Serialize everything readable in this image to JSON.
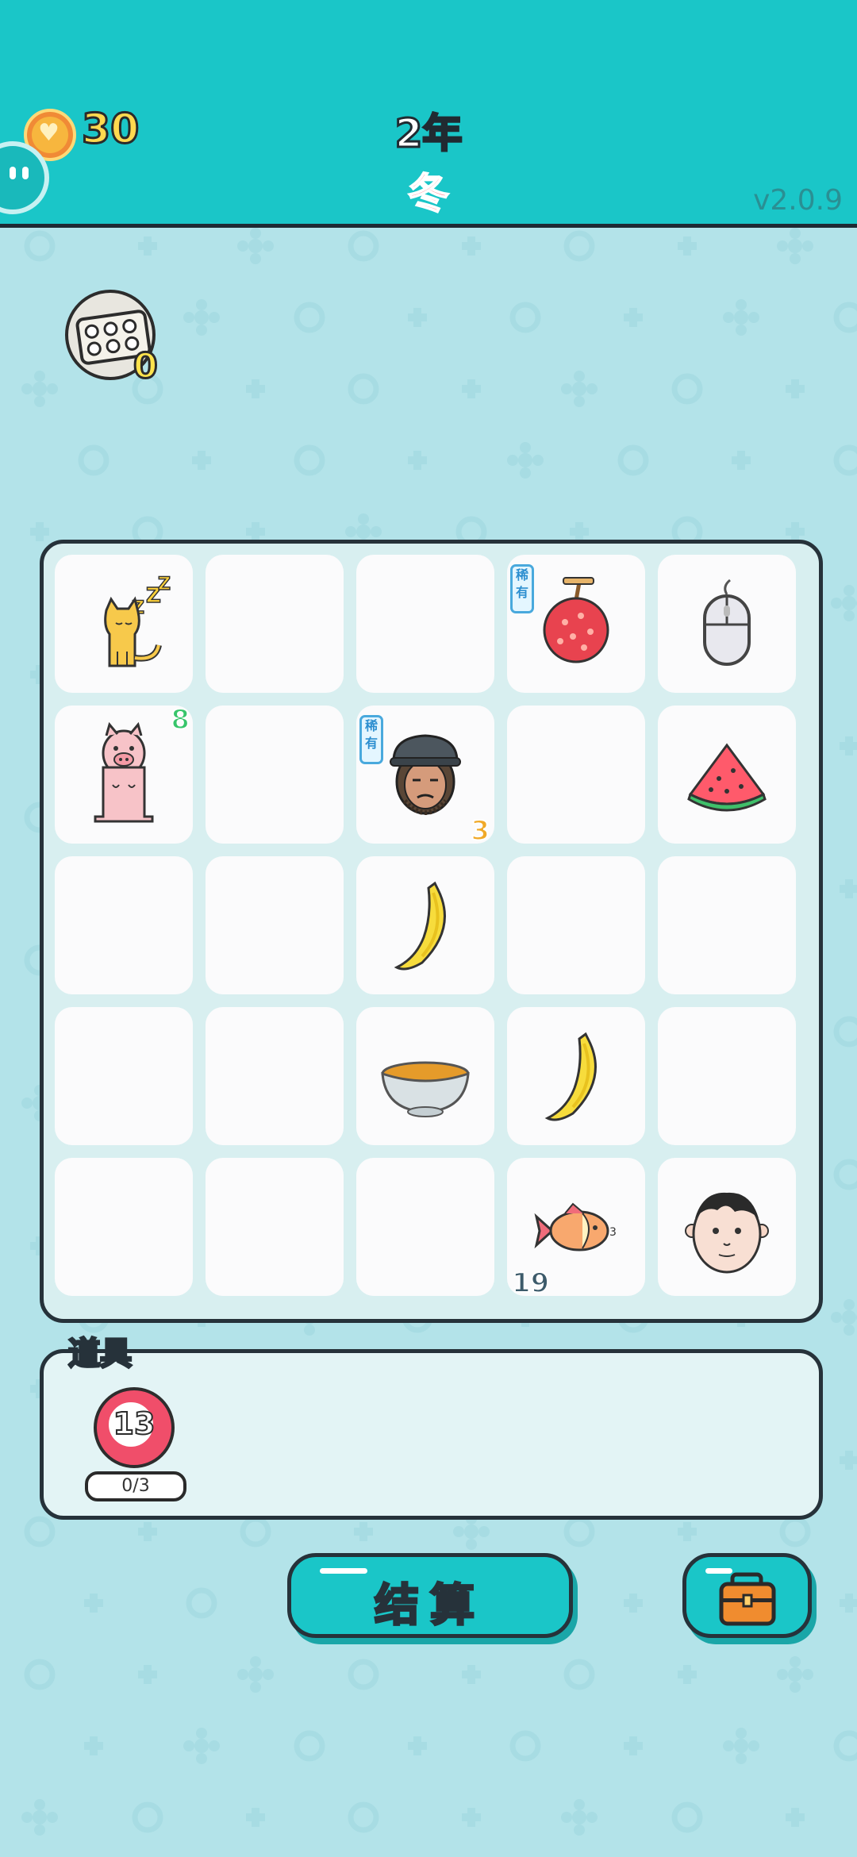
{
  "header": {
    "coins": "30",
    "year": "2年",
    "season": "冬",
    "version": "v2.0.9"
  },
  "egg_tray": {
    "count": "0"
  },
  "board": {
    "rows": 5,
    "cols": 5,
    "cells": [
      {
        "item": "sleeping-cat",
        "rare": false,
        "count": ""
      },
      {
        "item": "",
        "rare": false,
        "count": ""
      },
      {
        "item": "",
        "rare": false,
        "count": ""
      },
      {
        "item": "lychee",
        "rare": true,
        "count": ""
      },
      {
        "item": "computer-mouse",
        "rare": false,
        "count": ""
      },
      {
        "item": "pig",
        "rare": false,
        "count": "8"
      },
      {
        "item": "",
        "rare": false,
        "count": ""
      },
      {
        "item": "hat-man",
        "rare": true,
        "count": "3"
      },
      {
        "item": "",
        "rare": false,
        "count": ""
      },
      {
        "item": "watermelon-slice",
        "rare": false,
        "count": ""
      },
      {
        "item": "",
        "rare": false,
        "count": ""
      },
      {
        "item": "",
        "rare": false,
        "count": ""
      },
      {
        "item": "banana",
        "rare": false,
        "count": ""
      },
      {
        "item": "",
        "rare": false,
        "count": ""
      },
      {
        "item": "",
        "rare": false,
        "count": ""
      },
      {
        "item": "",
        "rare": false,
        "count": ""
      },
      {
        "item": "",
        "rare": false,
        "count": ""
      },
      {
        "item": "soup-bowl",
        "rare": false,
        "count": ""
      },
      {
        "item": "banana",
        "rare": false,
        "count": ""
      },
      {
        "item": "",
        "rare": false,
        "count": ""
      },
      {
        "item": "",
        "rare": false,
        "count": ""
      },
      {
        "item": "",
        "rare": false,
        "count": ""
      },
      {
        "item": "",
        "rare": false,
        "count": ""
      },
      {
        "item": "goldfish",
        "rare": false,
        "count": "19"
      },
      {
        "item": "man-face",
        "rare": false,
        "count": ""
      }
    ],
    "rare_label": "稀有",
    "count_colors": {
      "pig": "#37c56b",
      "hat-man": "#f0a928",
      "goldfish": "#3c5a6a"
    }
  },
  "tools": {
    "label": "道具",
    "item_icon": "target-icon",
    "item_value": "13",
    "item_uses": "0/3"
  },
  "buttons": {
    "settle_label": "结算",
    "bag_icon": "briefcase-icon"
  },
  "colors": {
    "header": "#1ac6c8",
    "background": "#b3e3e9",
    "coin_text": "#ffd94f",
    "season_text": "#ff5a6e"
  }
}
